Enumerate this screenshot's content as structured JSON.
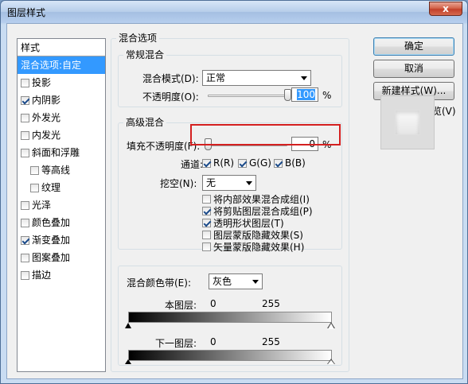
{
  "window": {
    "title": "图层样式",
    "close_label": "x"
  },
  "sidebar": {
    "header": "样式",
    "items": [
      {
        "label": "混合选项:自定",
        "checkbox": false,
        "checked": false,
        "selected": true,
        "indent": false
      },
      {
        "label": "投影",
        "checkbox": true,
        "checked": false,
        "selected": false,
        "indent": false
      },
      {
        "label": "内阴影",
        "checkbox": true,
        "checked": true,
        "selected": false,
        "indent": false
      },
      {
        "label": "外发光",
        "checkbox": true,
        "checked": false,
        "selected": false,
        "indent": false
      },
      {
        "label": "内发光",
        "checkbox": true,
        "checked": false,
        "selected": false,
        "indent": false
      },
      {
        "label": "斜面和浮雕",
        "checkbox": true,
        "checked": false,
        "selected": false,
        "indent": false
      },
      {
        "label": "等高线",
        "checkbox": true,
        "checked": false,
        "selected": false,
        "indent": true
      },
      {
        "label": "纹理",
        "checkbox": true,
        "checked": false,
        "selected": false,
        "indent": true
      },
      {
        "label": "光泽",
        "checkbox": true,
        "checked": false,
        "selected": false,
        "indent": false
      },
      {
        "label": "颜色叠加",
        "checkbox": true,
        "checked": false,
        "selected": false,
        "indent": false
      },
      {
        "label": "渐变叠加",
        "checkbox": true,
        "checked": true,
        "selected": false,
        "indent": false
      },
      {
        "label": "图案叠加",
        "checkbox": true,
        "checked": false,
        "selected": false,
        "indent": false
      },
      {
        "label": "描边",
        "checkbox": true,
        "checked": false,
        "selected": false,
        "indent": false
      }
    ]
  },
  "blend_options": {
    "group_title": "混合选项",
    "general": {
      "title": "常规混合",
      "mode_label": "混合模式(D):",
      "mode_value": "正常",
      "opacity_label": "不透明度(O):",
      "opacity_value": "100",
      "opacity_unit": "%",
      "opacity_level": 1.0
    },
    "advanced": {
      "title": "高级混合",
      "fill_label": "填充不透明度(F):",
      "fill_value": "0",
      "fill_unit": "%",
      "fill_level": 0.0,
      "channels_label": "通道:",
      "channels": [
        {
          "label": "R(R)",
          "checked": true
        },
        {
          "label": "G(G)",
          "checked": true
        },
        {
          "label": "B(B)",
          "checked": true
        }
      ],
      "knockout_label": "挖空(N):",
      "knockout_value": "无",
      "options": [
        {
          "label": "将内部效果混合成组(I)",
          "checked": false
        },
        {
          "label": "将剪贴图层混合成组(P)",
          "checked": true
        },
        {
          "label": "透明形状图层(T)",
          "checked": true
        },
        {
          "label": "图层蒙版隐藏效果(S)",
          "checked": false
        },
        {
          "label": "矢量蒙版隐藏效果(H)",
          "checked": false
        }
      ]
    },
    "blend_if": {
      "label": "混合颜色带(E):",
      "value": "灰色",
      "this_layer_label": "本图层:",
      "this_layer_min": "0",
      "this_layer_max": "255",
      "underlying_label": "下一图层:",
      "underlying_min": "0",
      "underlying_max": "255"
    }
  },
  "buttons": {
    "ok": "确定",
    "cancel": "取消",
    "new_style": "新建样式(W)...",
    "preview_label": "预览(V)",
    "preview_checked": true
  },
  "colors": {
    "selection": "#3399ff",
    "highlight_box": "#d42020"
  }
}
